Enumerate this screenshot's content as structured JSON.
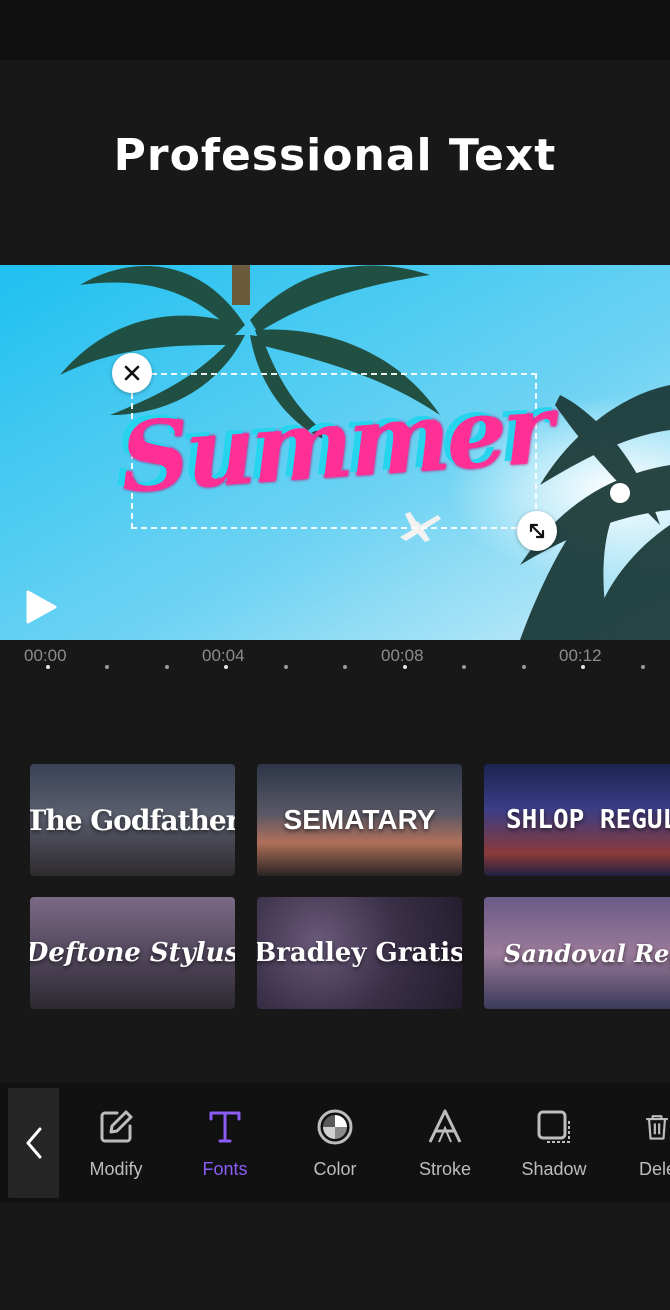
{
  "headline": "Professional Text",
  "preview": {
    "text_overlay": "Summer"
  },
  "timeline": {
    "labels": [
      "00:00",
      "00:04",
      "00:08",
      "00:12"
    ]
  },
  "fonts": [
    {
      "label": "The Godfather"
    },
    {
      "label": "SEMATARY"
    },
    {
      "label": "SHLOP REGULAR"
    },
    {
      "label": "Deftone Stylus"
    },
    {
      "label": "Bradley Gratis"
    },
    {
      "label": "Sandoval Regular"
    }
  ],
  "toolbar": {
    "modify": "Modify",
    "fonts": "Fonts",
    "color": "Color",
    "stroke": "Stroke",
    "shadow": "Shadow",
    "delete": "Delete",
    "active": "Fonts"
  },
  "colors": {
    "accent": "#8b5cf6",
    "background": "#181818",
    "sky": "#39c6ee"
  }
}
